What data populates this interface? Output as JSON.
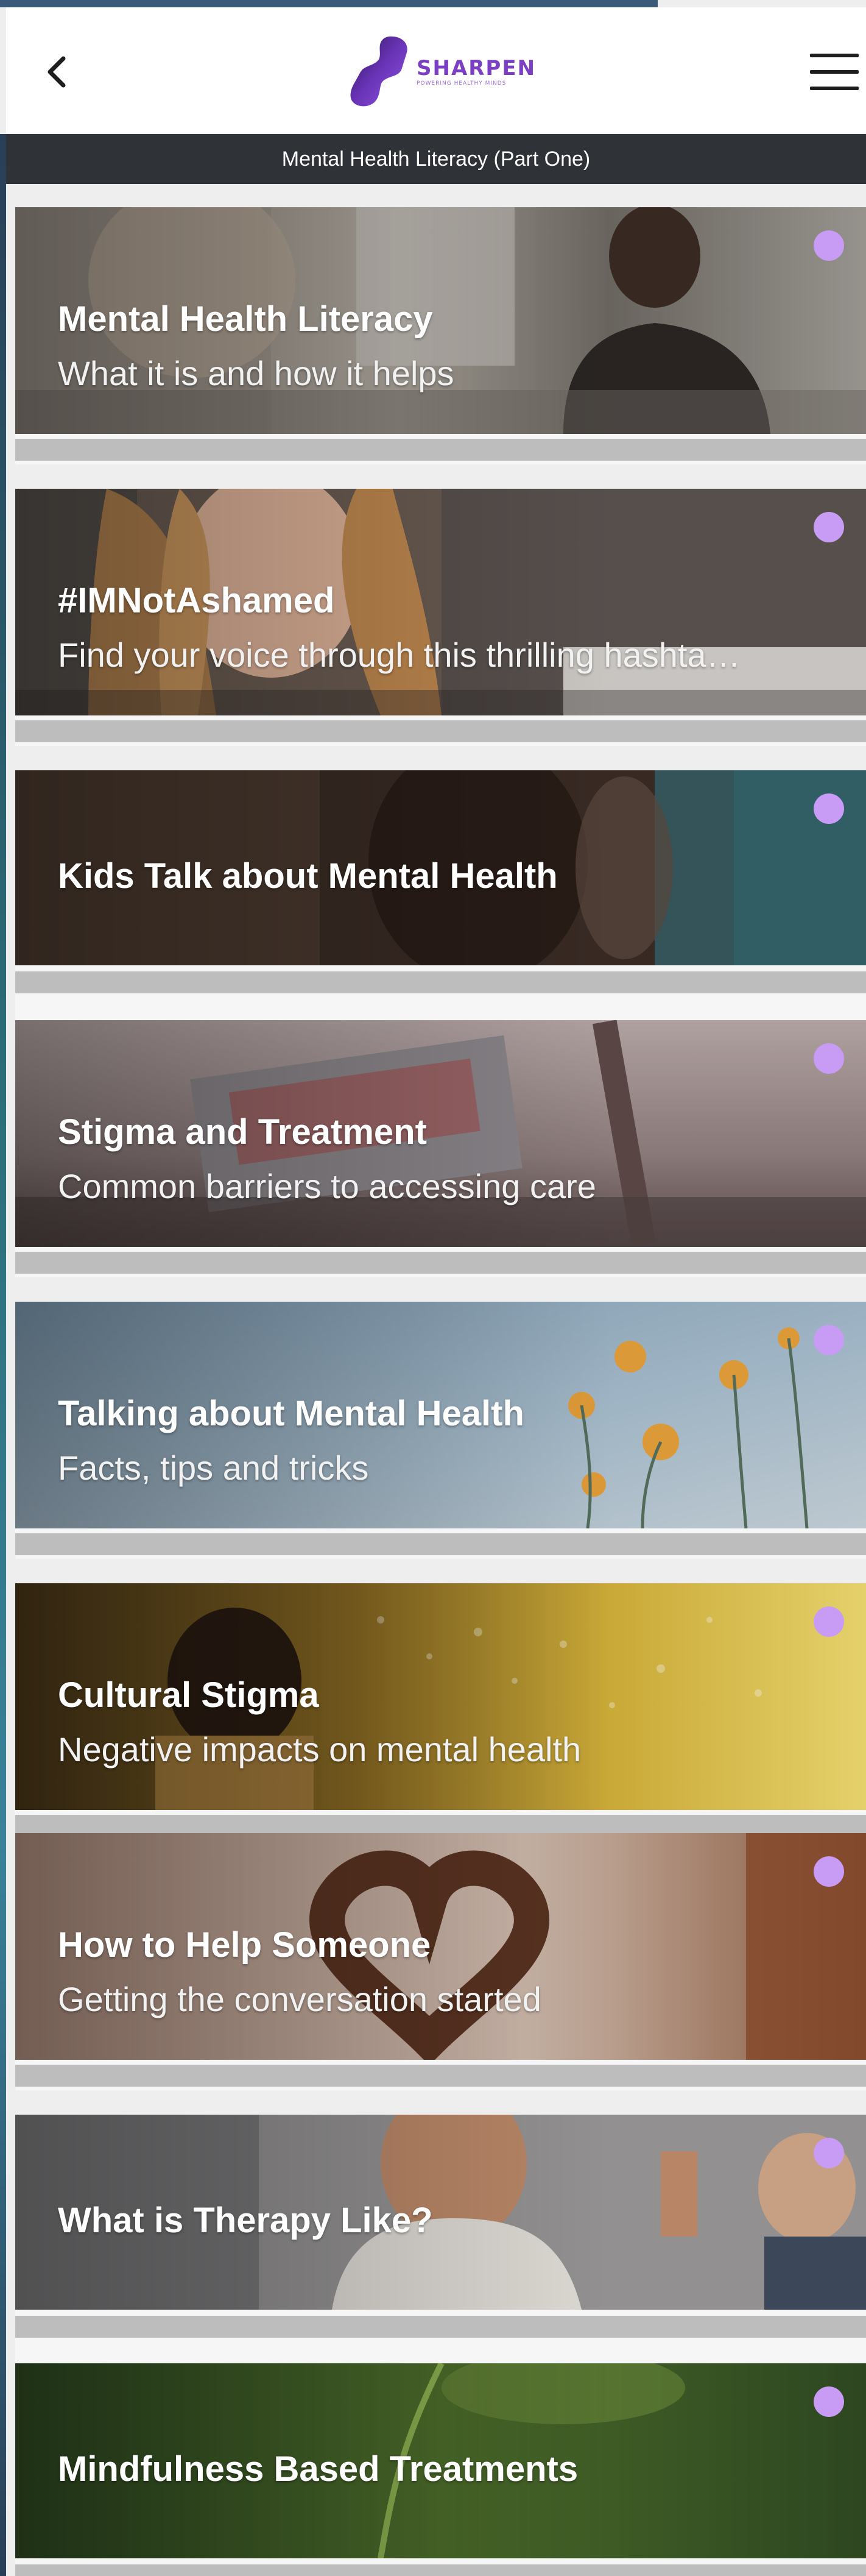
{
  "header": {
    "back_icon": "chevron-left-icon",
    "logo_name": "SHARPEN",
    "logo_tagline": "POWERING HEALTHY MINDS",
    "menu_icon": "hamburger-menu-icon",
    "brand_color": "#7b3fc4"
  },
  "subheader": {
    "title": "Mental Health Literacy (Part One)"
  },
  "cards": [
    {
      "title": "Mental Health Literacy",
      "subtitle": "What it is and how it helps",
      "status_color": "#c89cf4",
      "progress": 0
    },
    {
      "title": "#IMNotAshamed",
      "subtitle": "Find your voice through this thrilling hashta…",
      "status_color": "#c89cf4",
      "progress": 0
    },
    {
      "title": "Kids Talk about Mental Health",
      "subtitle": "",
      "status_color": "#c89cf4",
      "progress": 0
    },
    {
      "title": "Stigma and Treatment",
      "subtitle": "Common barriers to accessing care",
      "status_color": "#c89cf4",
      "progress": 0
    },
    {
      "title": "Talking about Mental Health",
      "subtitle": "Facts, tips and tricks",
      "status_color": "#c89cf4",
      "progress": 0
    },
    {
      "title": "Cultural Stigma",
      "subtitle": "Negative impacts on mental health",
      "status_color": "#c89cf4",
      "progress": 0
    },
    {
      "title": "How to Help Someone",
      "subtitle": "Getting the conversation started",
      "status_color": "#c89cf4",
      "progress": 0
    },
    {
      "title": "What is Therapy Like?",
      "subtitle": "",
      "status_color": "#c89cf4",
      "progress": 0
    },
    {
      "title": "Mindfulness Based Treatments",
      "subtitle": "",
      "status_color": "#c89cf4",
      "progress": 0
    }
  ]
}
